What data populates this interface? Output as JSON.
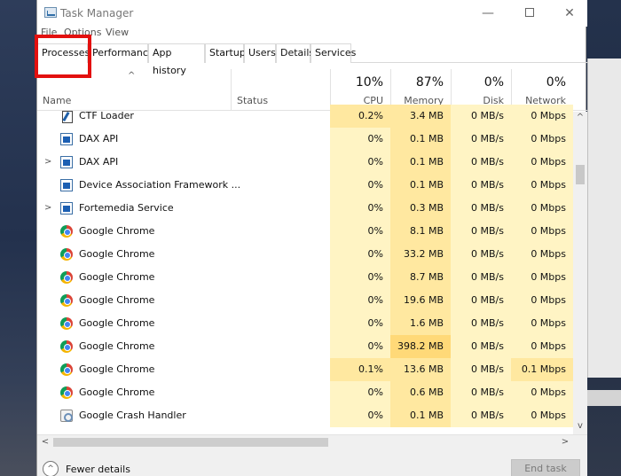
{
  "window": {
    "title": "Task Manager",
    "minimize_glyph": "—",
    "close_glyph": "✕"
  },
  "menu": [
    "File",
    "Options",
    "View"
  ],
  "tabs": [
    "Processes",
    "Performance",
    "App history",
    "Startup",
    "Users",
    "Details",
    "Services"
  ],
  "active_tab": "Processes",
  "header": {
    "sort_glyph": "^",
    "name_label": "Name",
    "status_label": "Status",
    "columns": [
      {
        "pct": "10%",
        "label": "CPU"
      },
      {
        "pct": "87%",
        "label": "Memory"
      },
      {
        "pct": "0%",
        "label": "Disk"
      },
      {
        "pct": "0%",
        "label": "Network"
      }
    ]
  },
  "rows": [
    {
      "name": "CTF Loader",
      "icon": "ctf-loader-icon",
      "expandable": false,
      "cpu": "0.2%",
      "memory": "3.4 MB",
      "disk": "0 MB/s",
      "network": "0 Mbps"
    },
    {
      "name": "DAX API",
      "icon": "app-icon",
      "expandable": false,
      "cpu": "0%",
      "memory": "0.1 MB",
      "disk": "0 MB/s",
      "network": "0 Mbps"
    },
    {
      "name": "DAX API",
      "icon": "app-icon",
      "expandable": true,
      "cpu": "0%",
      "memory": "0.1 MB",
      "disk": "0 MB/s",
      "network": "0 Mbps"
    },
    {
      "name": "Device Association Framework ...",
      "icon": "app-icon",
      "expandable": false,
      "cpu": "0%",
      "memory": "0.1 MB",
      "disk": "0 MB/s",
      "network": "0 Mbps"
    },
    {
      "name": "Fortemedia Service",
      "icon": "app-icon",
      "expandable": true,
      "cpu": "0%",
      "memory": "0.3 MB",
      "disk": "0 MB/s",
      "network": "0 Mbps"
    },
    {
      "name": "Google Chrome",
      "icon": "chrome-icon",
      "expandable": false,
      "cpu": "0%",
      "memory": "8.1 MB",
      "disk": "0 MB/s",
      "network": "0 Mbps"
    },
    {
      "name": "Google Chrome",
      "icon": "chrome-icon",
      "expandable": false,
      "cpu": "0%",
      "memory": "33.2 MB",
      "disk": "0 MB/s",
      "network": "0 Mbps"
    },
    {
      "name": "Google Chrome",
      "icon": "chrome-icon",
      "expandable": false,
      "cpu": "0%",
      "memory": "8.7 MB",
      "disk": "0 MB/s",
      "network": "0 Mbps"
    },
    {
      "name": "Google Chrome",
      "icon": "chrome-icon",
      "expandable": false,
      "cpu": "0%",
      "memory": "19.6 MB",
      "disk": "0 MB/s",
      "network": "0 Mbps"
    },
    {
      "name": "Google Chrome",
      "icon": "chrome-icon",
      "expandable": false,
      "cpu": "0%",
      "memory": "1.6 MB",
      "disk": "0 MB/s",
      "network": "0 Mbps"
    },
    {
      "name": "Google Chrome",
      "icon": "chrome-icon",
      "expandable": false,
      "cpu": "0%",
      "memory": "398.2 MB",
      "disk": "0 MB/s",
      "network": "0 Mbps"
    },
    {
      "name": "Google Chrome",
      "icon": "chrome-icon",
      "expandable": false,
      "cpu": "0.1%",
      "memory": "13.6 MB",
      "disk": "0 MB/s",
      "network": "0.1 Mbps"
    },
    {
      "name": "Google Chrome",
      "icon": "chrome-icon",
      "expandable": false,
      "cpu": "0%",
      "memory": "0.6 MB",
      "disk": "0 MB/s",
      "network": "0 Mbps"
    },
    {
      "name": "Google Crash Handler",
      "icon": "crash-handler-icon",
      "expandable": false,
      "cpu": "0%",
      "memory": "0.1 MB",
      "disk": "0 MB/s",
      "network": "0 Mbps"
    }
  ],
  "heat_colors": {
    "light": "#fff4c4",
    "medium": "#ffe8a0",
    "strong": "#ffd978",
    "highlight_border": "#e3100f"
  },
  "footer": {
    "fewer_details_label": "Fewer details",
    "end_task_label": "End task"
  }
}
